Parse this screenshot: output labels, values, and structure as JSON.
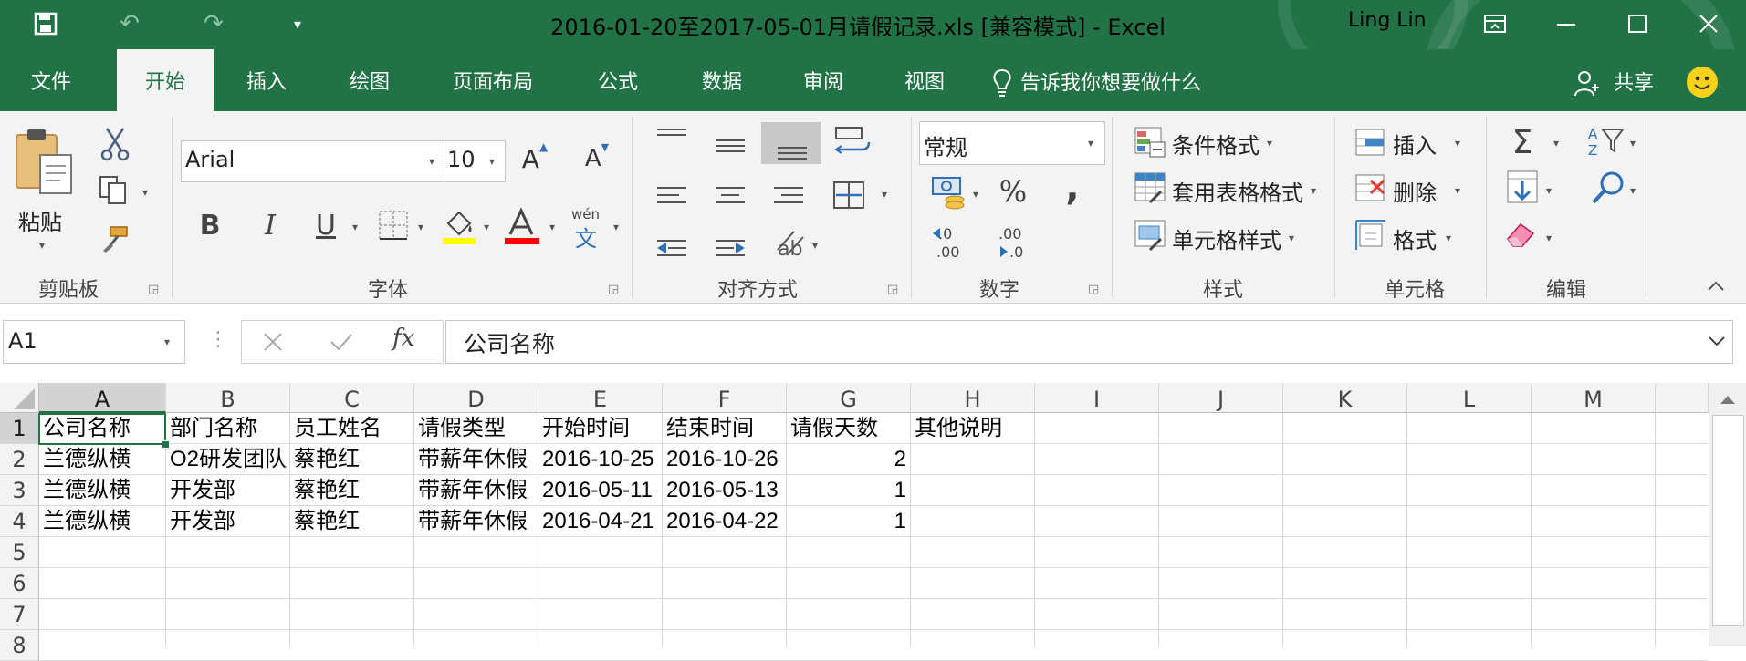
{
  "window": {
    "title": "2016-01-20至2017-05-01月请假记录.xls  [兼容模式]  -  Excel",
    "user": "Ling Lin"
  },
  "tabs": [
    "文件",
    "开始",
    "插入",
    "绘图",
    "页面布局",
    "公式",
    "数据",
    "审阅",
    "视图"
  ],
  "active_tab": "开始",
  "tell_me": "告诉我你想要做什么",
  "share": "共享",
  "ribbon": {
    "clipboard": {
      "label": "剪贴板",
      "paste": "粘贴"
    },
    "font": {
      "label": "字体",
      "name": "Arial",
      "size": "10",
      "bold": "B",
      "italic": "I",
      "underline": "U",
      "phonetic_top": "wén",
      "phonetic_bottom": "文"
    },
    "alignment": {
      "label": "对齐方式"
    },
    "number": {
      "label": "数字",
      "format": "常规",
      "percent": "%",
      "comma": ","
    },
    "styles": {
      "label": "样式",
      "conditional": "条件格式",
      "table": "套用表格格式",
      "cell_styles": "单元格样式"
    },
    "cells": {
      "label": "单元格",
      "insert": "插入",
      "delete": "删除",
      "format": "格式"
    },
    "editing": {
      "label": "编辑"
    }
  },
  "formula_bar": {
    "cell_ref": "A1",
    "fx": "fx",
    "value": "公司名称"
  },
  "columns": [
    "A",
    "B",
    "C",
    "D",
    "E",
    "F",
    "G",
    "H",
    "I",
    "J",
    "K",
    "L",
    "M"
  ],
  "rows": [
    "1",
    "2",
    "3",
    "4",
    "5",
    "6",
    "7",
    "8"
  ],
  "table": {
    "headers": [
      "公司名称",
      "部门名称",
      "员工姓名",
      "请假类型",
      "开始时间",
      "结束时间",
      "请假天数",
      "其他说明"
    ],
    "data": [
      [
        "兰德纵横",
        "O2研发团队",
        "蔡艳红",
        "带薪年休假",
        "2016-10-25",
        "2016-10-26",
        "2",
        ""
      ],
      [
        "兰德纵横",
        "开发部",
        "蔡艳红",
        "带薪年休假",
        "2016-05-11",
        "2016-05-13",
        "1",
        ""
      ],
      [
        "兰德纵横",
        "开发部",
        "蔡艳红",
        "带薪年休假",
        "2016-04-21",
        "2016-04-22",
        "1",
        ""
      ]
    ]
  },
  "colors": {
    "accent": "#217346",
    "selection": "#217346",
    "font_highlight": "#ffff00",
    "font_color": "#ff0000"
  }
}
